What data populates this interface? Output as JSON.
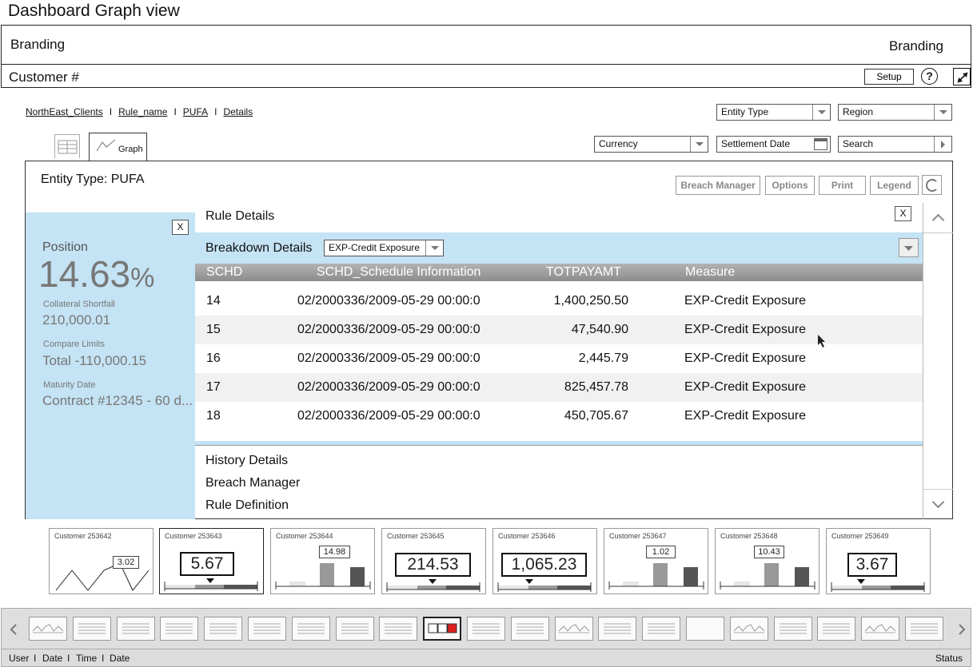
{
  "page_title": "Dashboard Graph view",
  "branding": {
    "left": "Branding",
    "right": "Branding"
  },
  "customer_bar": {
    "label": "Customer #",
    "setup_label": "Setup",
    "help_label": "?"
  },
  "breadcrumb": [
    {
      "label": "NorthEast_Clients"
    },
    {
      "label": "Rule_name"
    },
    {
      "label": "PUFA"
    },
    {
      "label": "Details"
    }
  ],
  "breadcrumb_separator": "I",
  "filters": {
    "entity_type": "Entity Type",
    "region": "Region",
    "currency": "Currency",
    "settlement_date": "Settlement Date",
    "search": "Search"
  },
  "tabs": {
    "graph_label": "Graph"
  },
  "panel": {
    "entity_title": "Entity Type: PUFA",
    "toolbar": {
      "breach_manager": "Breach Manager",
      "options": "Options",
      "print": "Print",
      "legend": "Legend"
    },
    "close_label": "X"
  },
  "left_pane": {
    "position_label": "Position",
    "position_value": "14.63",
    "position_unit": "%",
    "collateral_label": "Collateral Shortfall",
    "collateral_value": "210,000.01",
    "compare_label": "Compare Limits",
    "compare_value": "Total -110,000.15",
    "maturity_label": "Maturity Date",
    "maturity_value": "Contract #12345 - 60 d..."
  },
  "rule_details": {
    "title": "Rule Details",
    "breakdown_label": "Breakdown Details",
    "breakdown_select": "EXP-Credit Exposure",
    "columns": [
      "SCHD",
      "SCHD_Schedule Information",
      "TOTPAYAMT",
      "Measure"
    ],
    "rows": [
      {
        "schd": "14",
        "info": "02/2000336/2009-05-29 00:00:0",
        "amt": "1,400,250.50",
        "measure": "EXP-Credit Exposure"
      },
      {
        "schd": "15",
        "info": "02/2000336/2009-05-29 00:00:0",
        "amt": "47,540.90",
        "measure": "EXP-Credit Exposure"
      },
      {
        "schd": "16",
        "info": "02/2000336/2009-05-29 00:00:0",
        "amt": "2,445.79",
        "measure": "EXP-Credit Exposure"
      },
      {
        "schd": "17",
        "info": "02/2000336/2009-05-29 00:00:0",
        "amt": "825,457.78",
        "measure": "EXP-Credit Exposure"
      },
      {
        "schd": "18",
        "info": "02/2000336/2009-05-29 00:00:0",
        "amt": "450,705.67",
        "measure": "EXP-Credit Exposure"
      }
    ],
    "sections": [
      "History Details",
      "Breach Manager",
      "Rule Definition"
    ]
  },
  "customer_cards": [
    {
      "name": "Customer 253642",
      "kind": "line",
      "value": "3.02"
    },
    {
      "name": "Customer 253643",
      "kind": "gauge",
      "value": "5.67"
    },
    {
      "name": "Customer 253644",
      "kind": "bar",
      "value": "14.98"
    },
    {
      "name": "Customer 253645",
      "kind": "gauge",
      "value": "214.53"
    },
    {
      "name": "Customer 253646",
      "kind": "gauge",
      "value": "1,065.23"
    },
    {
      "name": "Customer 253647",
      "kind": "bar",
      "value": "1.02"
    },
    {
      "name": "Customer 253648",
      "kind": "bar",
      "value": "10.43"
    },
    {
      "name": "Customer 253649",
      "kind": "gauge",
      "value": "3.67"
    }
  ],
  "thumbnail_strip": [
    "line",
    "list",
    "list",
    "list",
    "list",
    "list",
    "list",
    "list",
    "list",
    "selected",
    "list",
    "list",
    "line",
    "list",
    "list",
    "blank",
    "line",
    "list",
    "list",
    "line",
    "list"
  ],
  "status_bar": {
    "left_items": [
      "User",
      "Date",
      "Time",
      "Date"
    ],
    "separator": "I",
    "right": "Status"
  },
  "colors": {
    "panel_blue": "#c4e3f4",
    "accent_red": "#e02020"
  }
}
